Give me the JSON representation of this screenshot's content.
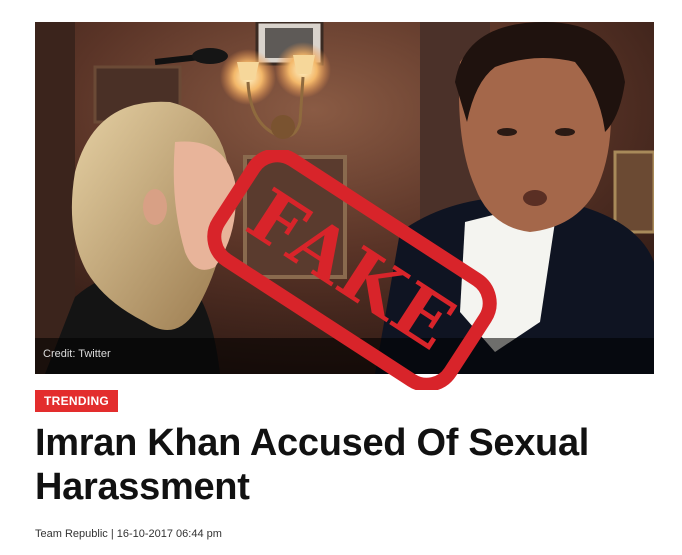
{
  "image": {
    "credit": "Credit: Twitter",
    "stamp_text": "FAKE"
  },
  "article": {
    "category": "TRENDING",
    "headline": "Imran Khan Accused Of Sexual Harassment",
    "byline": "Team Republic | 16-10-2017 06:44 pm"
  },
  "colors": {
    "accent_red": "#e32d2d",
    "stamp_red": "#d8242a",
    "headline_text": "#111111"
  }
}
